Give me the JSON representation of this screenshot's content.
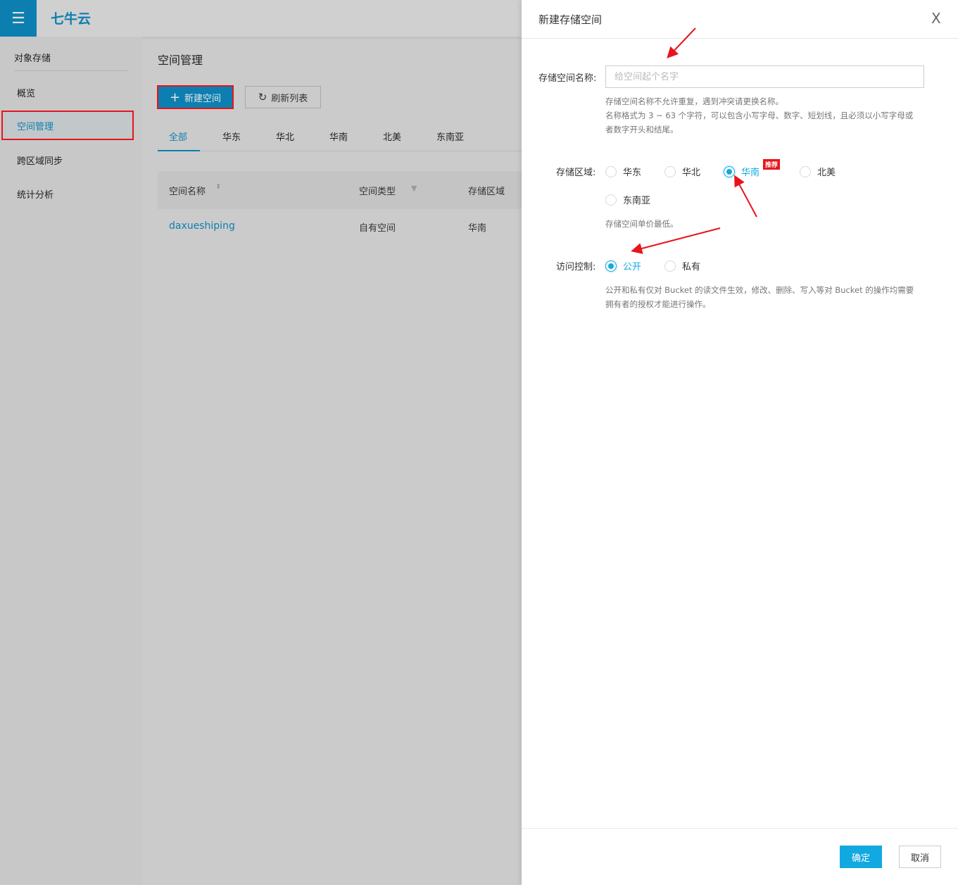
{
  "header": {
    "menu_icon": "hamburger-icon",
    "logo_text": "七牛云"
  },
  "sidebar": {
    "section_title": "对象存储",
    "items": [
      {
        "label": "概览"
      },
      {
        "label": "空间管理",
        "active": true
      },
      {
        "label": "跨区域同步"
      },
      {
        "label": "统计分析"
      }
    ]
  },
  "main": {
    "title": "空间管理",
    "new_button": "新建空间",
    "refresh_button": "刷新列表",
    "tabs": [
      "全部",
      "华东",
      "华北",
      "华南",
      "北美",
      "东南亚"
    ],
    "columns": [
      "空间名称",
      "空间类型",
      "存储区域"
    ],
    "rows": [
      {
        "name": "daxueshiping",
        "type": "自有空间",
        "region": "华南"
      }
    ]
  },
  "drawer": {
    "title": "新建存储空间",
    "close": "X",
    "name_label": "存储空间名称:",
    "name_placeholder": "给空间起个名字",
    "name_value": "",
    "name_help": [
      "存储空间名称不允许重复，遇到冲突请更换名称。",
      "名称格式为 3 ~ 63 个字符，可以包含小写字母、数字、短划线，且必须以小写字母或",
      "者数字开头和结尾。"
    ],
    "region_label": "存储区域:",
    "regions": [
      "华东",
      "华北",
      "华南",
      "北美",
      "东南亚"
    ],
    "region_selected": "华南",
    "recommend_badge": "推荐",
    "region_help": "存储空间单价最低。",
    "access_label": "访问控制:",
    "access_options": [
      "公开",
      "私有"
    ],
    "access_selected": "公开",
    "access_help": [
      "公开和私有仅对 Bucket 的读文件生效，修改、删除、写入等对 Bucket 的操作均需要",
      "拥有者的授权才能进行操作。"
    ],
    "ok_button": "确定",
    "cancel_button": "取消"
  },
  "colors": {
    "accent": "#11a9e0",
    "brand": "#0c7fb0",
    "annotation": "#e8141b"
  }
}
